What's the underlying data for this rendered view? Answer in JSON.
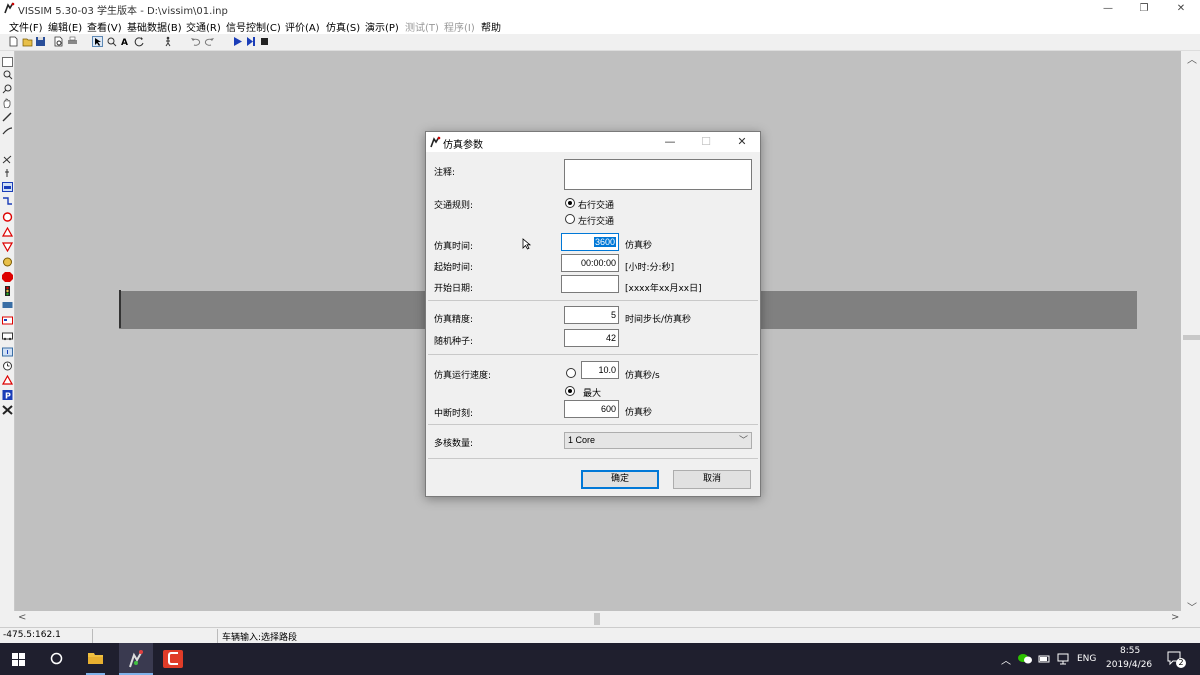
{
  "window": {
    "title": "VISSIM 5.30-03 学生版本 - D:\\vissim\\01.inp",
    "controls": {
      "minimize": "—",
      "maximize": "❐",
      "close": "✕"
    }
  },
  "menu": {
    "items": [
      {
        "label": "文件(F)",
        "enabled": true
      },
      {
        "label": "编辑(E)",
        "enabled": true
      },
      {
        "label": "查看(V)",
        "enabled": true
      },
      {
        "label": "基础数据(B)",
        "enabled": true
      },
      {
        "label": "交通(R)",
        "enabled": true
      },
      {
        "label": "信号控制(C)",
        "enabled": true
      },
      {
        "label": "评价(A)",
        "enabled": true
      },
      {
        "label": "仿真(S)",
        "enabled": true
      },
      {
        "label": "演示(P)",
        "enabled": true
      },
      {
        "label": "测试(T)",
        "enabled": false
      },
      {
        "label": "程序(I)",
        "enabled": false
      },
      {
        "label": "帮助",
        "enabled": true
      }
    ]
  },
  "colors": {
    "accent": "#0078d7",
    "canvas": "#c0c0c0",
    "road": "#808080",
    "taskbar": "#1f1f2e"
  },
  "dialog": {
    "title": "仿真参数",
    "controls": {
      "minimize": "—",
      "maximize": "☐",
      "close": "✕"
    },
    "comment_label": "注释:",
    "comment_value": "",
    "traffic_rule_label": "交通规则:",
    "traffic_rule_options": [
      "右行交通",
      "左行交通"
    ],
    "traffic_rule_selected": "右行交通",
    "sim_time_label": "仿真时间:",
    "sim_time_value": "3600",
    "sim_time_unit": "仿真秒",
    "start_time_label": "起始时间:",
    "start_time_value": "00:00:00",
    "start_time_unit": "[小时:分:秒]",
    "start_date_label": "开始日期:",
    "start_date_value": "",
    "start_date_unit": "[xxxx年xx月xx日]",
    "precision_label": "仿真精度:",
    "precision_value": "5",
    "precision_unit": "时间步长/仿真秒",
    "seed_label": "随机种子:",
    "seed_value": "42",
    "speed_label": "仿真运行速度:",
    "speed_value": "10.0",
    "speed_unit": "仿真秒/s",
    "speed_max_label": "最大",
    "speed_selected": "最大",
    "break_label": "中断时刻:",
    "break_value": "600",
    "break_unit": "仿真秒",
    "cores_label": "多核数量:",
    "cores_value": "1 Core",
    "ok_label": "确定",
    "cancel_label": "取消"
  },
  "status": {
    "coords": "-475.5:162.1",
    "message": "车辆输入:选择路段"
  },
  "taskbar": {
    "lang": "ENG",
    "time": "8:55",
    "date": "2019/4/26",
    "notification_count": "2"
  }
}
